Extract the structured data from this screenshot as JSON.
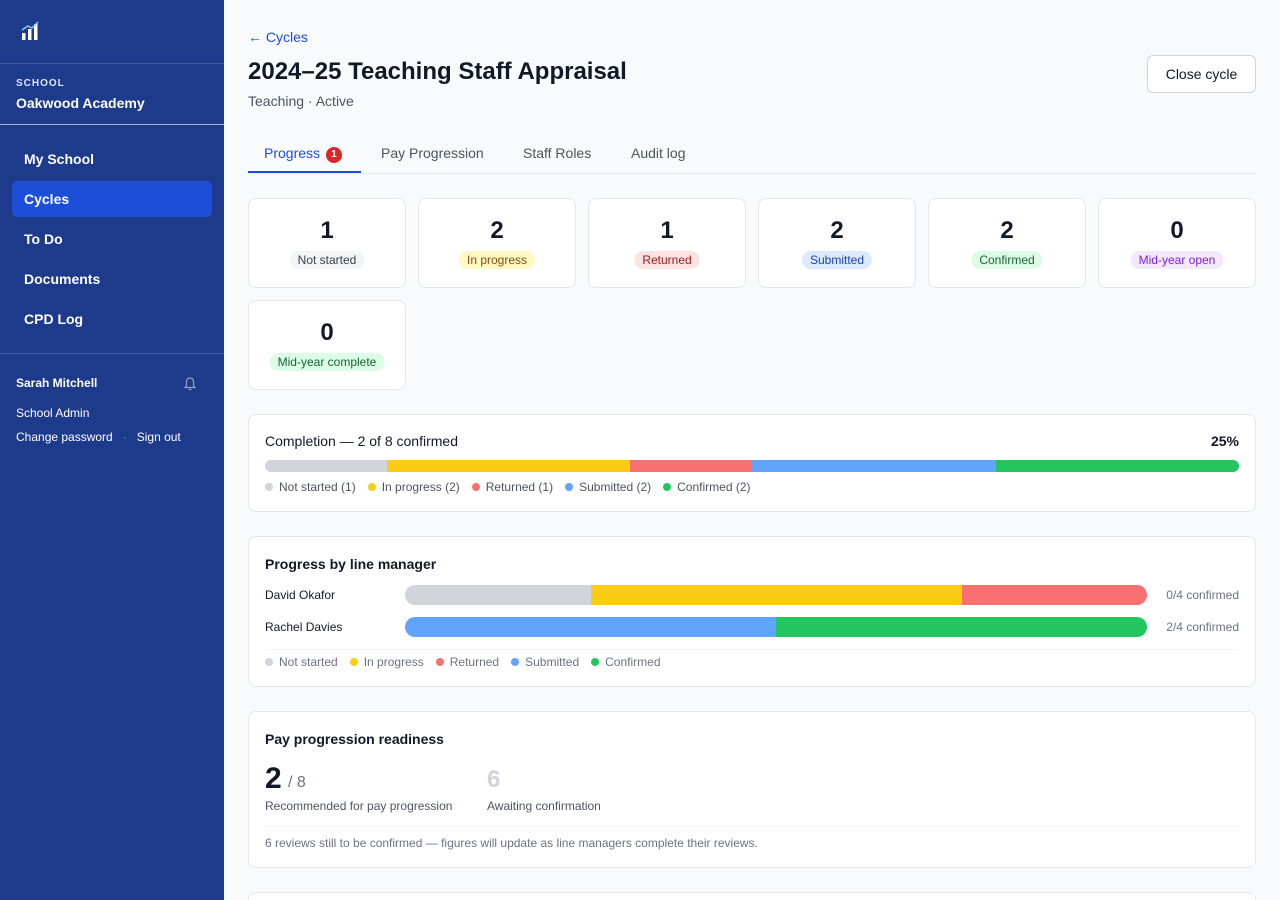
{
  "sidebar": {
    "school_label": "SCHOOL",
    "school_name": "Oakwood Academy",
    "nav": [
      {
        "label": "My School",
        "active": false
      },
      {
        "label": "Cycles",
        "active": true
      },
      {
        "label": "To Do",
        "active": false
      },
      {
        "label": "Documents",
        "active": false
      },
      {
        "label": "CPD Log",
        "active": false
      }
    ],
    "user_name": "Sarah Mitchell",
    "user_role": "School Admin",
    "change_password": "Change password",
    "sign_out": "Sign out"
  },
  "header": {
    "back_label": "← Cycles",
    "title": "2024–25 Teaching Staff Appraisal",
    "subtitle": "Teaching · Active",
    "close_button": "Close cycle"
  },
  "tabs": [
    {
      "label": "Progress",
      "badge": "1",
      "active": true
    },
    {
      "label": "Pay Progression",
      "active": false
    },
    {
      "label": "Staff Roles",
      "active": false
    },
    {
      "label": "Audit log",
      "active": false
    }
  ],
  "status_cards": [
    {
      "count": "1",
      "label": "Not started",
      "bg": "#f3f4f6",
      "fg": "#374151"
    },
    {
      "count": "2",
      "label": "In progress",
      "bg": "#fef9c3",
      "fg": "#854d0e"
    },
    {
      "count": "1",
      "label": "Returned",
      "bg": "#fee2e2",
      "fg": "#991b1b"
    },
    {
      "count": "2",
      "label": "Submitted",
      "bg": "#dbeafe",
      "fg": "#1e40af"
    },
    {
      "count": "2",
      "label": "Confirmed",
      "bg": "#dcfce7",
      "fg": "#166534"
    },
    {
      "count": "0",
      "label": "Mid-year open",
      "bg": "#f3e8ff",
      "fg": "#7e22ce"
    },
    {
      "count": "0",
      "label": "Mid-year complete",
      "bg": "#dcfce7",
      "fg": "#166534"
    }
  ],
  "colors": {
    "not_started": "#d1d5db",
    "in_progress": "#facc15",
    "returned": "#f87171",
    "submitted": "#60a5fa",
    "confirmed": "#22c55e"
  },
  "completion": {
    "title": "Completion — 2 of 8 confirmed",
    "percent": "25%",
    "segments": [
      {
        "key": "not_started",
        "count": 1,
        "legend": "Not started (1)"
      },
      {
        "key": "in_progress",
        "count": 2,
        "legend": "In progress (2)"
      },
      {
        "key": "returned",
        "count": 1,
        "legend": "Returned (1)"
      },
      {
        "key": "submitted",
        "count": 2,
        "legend": "Submitted (2)"
      },
      {
        "key": "confirmed",
        "count": 2,
        "legend": "Confirmed (2)"
      }
    ]
  },
  "line_managers": {
    "title": "Progress by line manager",
    "rows": [
      {
        "name": "David Okafor",
        "summary": "0/4 confirmed",
        "counts": {
          "not_started": 1,
          "in_progress": 2,
          "returned": 1,
          "submitted": 0,
          "confirmed": 0
        }
      },
      {
        "name": "Rachel Davies",
        "summary": "2/4 confirmed",
        "counts": {
          "not_started": 0,
          "in_progress": 0,
          "returned": 0,
          "submitted": 2,
          "confirmed": 2
        }
      }
    ],
    "legend": [
      {
        "key": "not_started",
        "label": "Not started"
      },
      {
        "key": "in_progress",
        "label": "In progress"
      },
      {
        "key": "returned",
        "label": "Returned"
      },
      {
        "key": "submitted",
        "label": "Submitted"
      },
      {
        "key": "confirmed",
        "label": "Confirmed"
      }
    ]
  },
  "pay": {
    "title": "Pay progression readiness",
    "recommended": "2",
    "of_total": "/ 8",
    "recommended_label": "Recommended for pay progression",
    "awaiting": "6",
    "awaiting_label": "Awaiting confirmation",
    "note": "6 reviews still to be confirmed — figures will update as line managers complete their reviews."
  }
}
